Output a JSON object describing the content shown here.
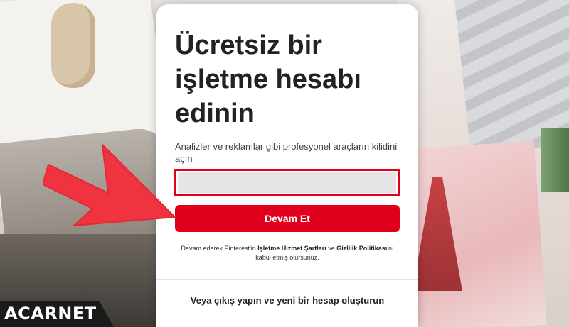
{
  "modal": {
    "title": "Ücretsiz bir işletme hesabı edinin",
    "subtitle": "Analizler ve reklamlar gibi profesyonel araçların kilidini açın",
    "email_value": "",
    "continue_label": "Devam Et",
    "terms": {
      "prefix": "Devam ederek Pinterest'in ",
      "terms_link": "İşletme Hizmet Şartları",
      "middle": " ve ",
      "privacy_link": "Gizlilik Politikası",
      "suffix": "'nı kabul etmiş olursunuz."
    },
    "alt_link": "Veya çıkış yapın ve yeni bir hesap oluşturun"
  },
  "watermark": {
    "text": "ACARNET"
  },
  "colors": {
    "accent": "#e0001b",
    "arrow": "#f0343f"
  },
  "annotations": {
    "arrow_icon": "arrow-pointing-right"
  }
}
